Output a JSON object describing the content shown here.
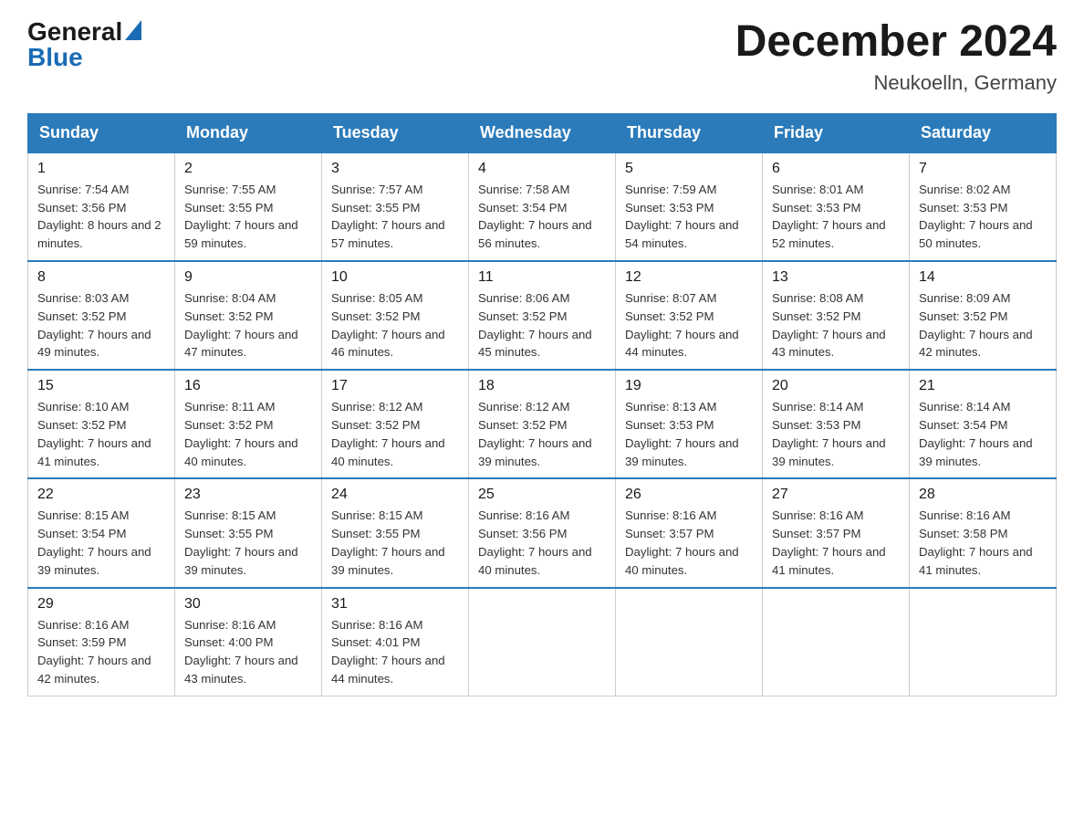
{
  "header": {
    "logo_general": "General",
    "logo_blue": "Blue",
    "month_title": "December 2024",
    "location": "Neukoelln, Germany"
  },
  "weekdays": [
    "Sunday",
    "Monday",
    "Tuesday",
    "Wednesday",
    "Thursday",
    "Friday",
    "Saturday"
  ],
  "weeks": [
    [
      {
        "day": "1",
        "sunrise": "7:54 AM",
        "sunset": "3:56 PM",
        "daylight": "8 hours and 2 minutes."
      },
      {
        "day": "2",
        "sunrise": "7:55 AM",
        "sunset": "3:55 PM",
        "daylight": "7 hours and 59 minutes."
      },
      {
        "day": "3",
        "sunrise": "7:57 AM",
        "sunset": "3:55 PM",
        "daylight": "7 hours and 57 minutes."
      },
      {
        "day": "4",
        "sunrise": "7:58 AM",
        "sunset": "3:54 PM",
        "daylight": "7 hours and 56 minutes."
      },
      {
        "day": "5",
        "sunrise": "7:59 AM",
        "sunset": "3:53 PM",
        "daylight": "7 hours and 54 minutes."
      },
      {
        "day": "6",
        "sunrise": "8:01 AM",
        "sunset": "3:53 PM",
        "daylight": "7 hours and 52 minutes."
      },
      {
        "day": "7",
        "sunrise": "8:02 AM",
        "sunset": "3:53 PM",
        "daylight": "7 hours and 50 minutes."
      }
    ],
    [
      {
        "day": "8",
        "sunrise": "8:03 AM",
        "sunset": "3:52 PM",
        "daylight": "7 hours and 49 minutes."
      },
      {
        "day": "9",
        "sunrise": "8:04 AM",
        "sunset": "3:52 PM",
        "daylight": "7 hours and 47 minutes."
      },
      {
        "day": "10",
        "sunrise": "8:05 AM",
        "sunset": "3:52 PM",
        "daylight": "7 hours and 46 minutes."
      },
      {
        "day": "11",
        "sunrise": "8:06 AM",
        "sunset": "3:52 PM",
        "daylight": "7 hours and 45 minutes."
      },
      {
        "day": "12",
        "sunrise": "8:07 AM",
        "sunset": "3:52 PM",
        "daylight": "7 hours and 44 minutes."
      },
      {
        "day": "13",
        "sunrise": "8:08 AM",
        "sunset": "3:52 PM",
        "daylight": "7 hours and 43 minutes."
      },
      {
        "day": "14",
        "sunrise": "8:09 AM",
        "sunset": "3:52 PM",
        "daylight": "7 hours and 42 minutes."
      }
    ],
    [
      {
        "day": "15",
        "sunrise": "8:10 AM",
        "sunset": "3:52 PM",
        "daylight": "7 hours and 41 minutes."
      },
      {
        "day": "16",
        "sunrise": "8:11 AM",
        "sunset": "3:52 PM",
        "daylight": "7 hours and 40 minutes."
      },
      {
        "day": "17",
        "sunrise": "8:12 AM",
        "sunset": "3:52 PM",
        "daylight": "7 hours and 40 minutes."
      },
      {
        "day": "18",
        "sunrise": "8:12 AM",
        "sunset": "3:52 PM",
        "daylight": "7 hours and 39 minutes."
      },
      {
        "day": "19",
        "sunrise": "8:13 AM",
        "sunset": "3:53 PM",
        "daylight": "7 hours and 39 minutes."
      },
      {
        "day": "20",
        "sunrise": "8:14 AM",
        "sunset": "3:53 PM",
        "daylight": "7 hours and 39 minutes."
      },
      {
        "day": "21",
        "sunrise": "8:14 AM",
        "sunset": "3:54 PM",
        "daylight": "7 hours and 39 minutes."
      }
    ],
    [
      {
        "day": "22",
        "sunrise": "8:15 AM",
        "sunset": "3:54 PM",
        "daylight": "7 hours and 39 minutes."
      },
      {
        "day": "23",
        "sunrise": "8:15 AM",
        "sunset": "3:55 PM",
        "daylight": "7 hours and 39 minutes."
      },
      {
        "day": "24",
        "sunrise": "8:15 AM",
        "sunset": "3:55 PM",
        "daylight": "7 hours and 39 minutes."
      },
      {
        "day": "25",
        "sunrise": "8:16 AM",
        "sunset": "3:56 PM",
        "daylight": "7 hours and 40 minutes."
      },
      {
        "day": "26",
        "sunrise": "8:16 AM",
        "sunset": "3:57 PM",
        "daylight": "7 hours and 40 minutes."
      },
      {
        "day": "27",
        "sunrise": "8:16 AM",
        "sunset": "3:57 PM",
        "daylight": "7 hours and 41 minutes."
      },
      {
        "day": "28",
        "sunrise": "8:16 AM",
        "sunset": "3:58 PM",
        "daylight": "7 hours and 41 minutes."
      }
    ],
    [
      {
        "day": "29",
        "sunrise": "8:16 AM",
        "sunset": "3:59 PM",
        "daylight": "7 hours and 42 minutes."
      },
      {
        "day": "30",
        "sunrise": "8:16 AM",
        "sunset": "4:00 PM",
        "daylight": "7 hours and 43 minutes."
      },
      {
        "day": "31",
        "sunrise": "8:16 AM",
        "sunset": "4:01 PM",
        "daylight": "7 hours and 44 minutes."
      },
      null,
      null,
      null,
      null
    ]
  ]
}
